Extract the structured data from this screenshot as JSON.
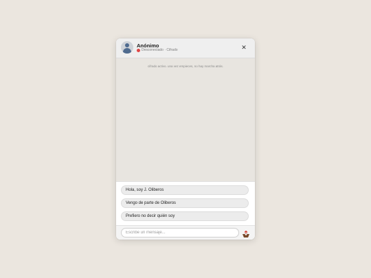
{
  "header": {
    "name": "Anónimo",
    "status": "Desconectado · Cifrado",
    "close_symbol": "✕",
    "avatar_icon": "user-avatar-icon",
    "status_color": "#e04545"
  },
  "messages": {
    "system_notice": "cifrado activo. una vez empieces, no hay marcha atrás."
  },
  "quick_replies": [
    {
      "label": "Hola, soy J. Oliberos"
    },
    {
      "label": "Vengo de parte de Oliberos"
    },
    {
      "label": "Prefiero no decir quién soy"
    }
  ],
  "input": {
    "placeholder": "Escribe un mensaje...",
    "send_icon": "send-tray-icon"
  },
  "colors": {
    "page_background": "#ebe6df",
    "messages_background": "#e8e5e0",
    "header_background": "#efefef"
  }
}
